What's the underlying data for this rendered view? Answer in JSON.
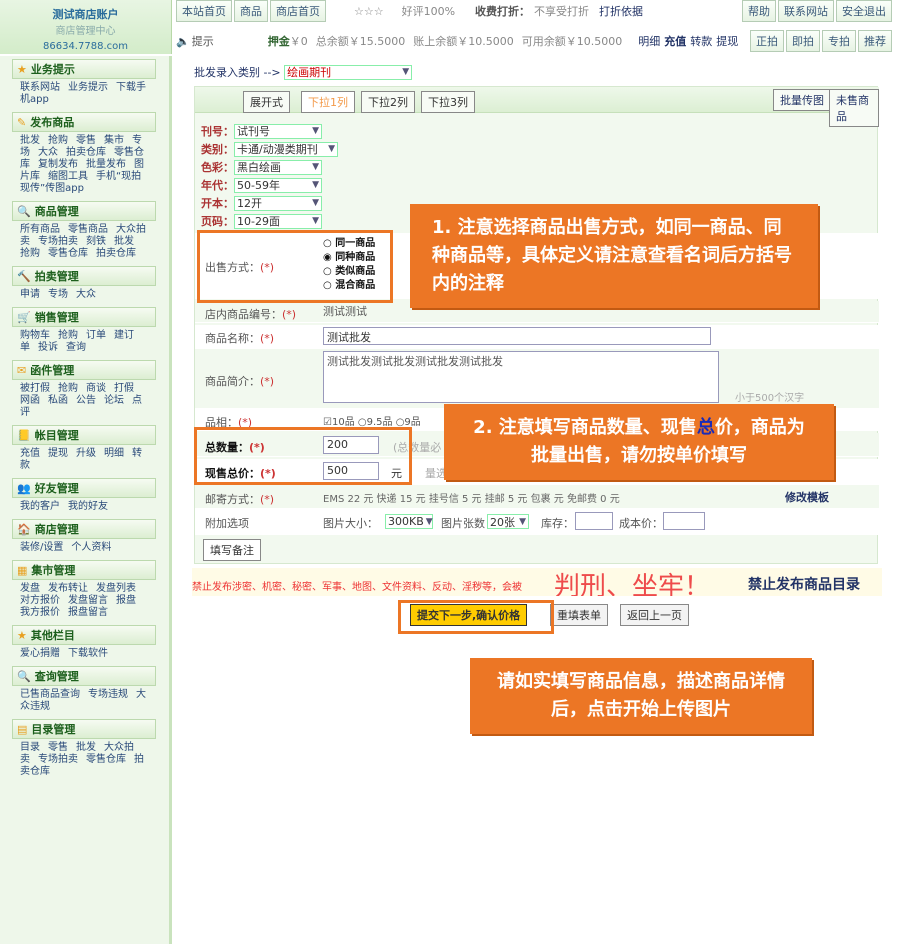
{
  "header": {
    "logo_title": "测试商店账户",
    "logo_sub": "商店管理中心",
    "logo_url": "86634.7788.com",
    "row1": [
      "本站首页",
      "商品",
      "商店首页"
    ],
    "stars": "☆☆☆",
    "rating": "好评100%",
    "fee_label": "收费打折：",
    "fee_value": "不享受打折",
    "fee_link": "打折依据",
    "row1_right": [
      "帮助",
      "联系网站",
      "安全退出"
    ],
    "tip": "提示",
    "deposit_label": "押金",
    "deposit_value": "￥0",
    "balance": "总余额￥15.5000",
    "account": "账上余额￥10.5000",
    "available": "可用余额￥10.5000",
    "links": [
      "明细",
      "充值",
      "转款",
      "提现"
    ],
    "row2_right": [
      "正拍",
      "即拍",
      "专拍",
      "推荐"
    ]
  },
  "sidebar": [
    {
      "title": "业务提示",
      "items": [
        "联系网站",
        "业务提示",
        "下载手机app"
      ]
    },
    {
      "title": "发布商品",
      "items": [
        "批发",
        "抢购",
        "零售",
        "集市",
        "专场",
        "大众",
        "拍卖仓库",
        "零售仓库",
        "复制发布",
        "批量发布",
        "图片库",
        "缩图工具",
        "手机“现拍现传”传图app"
      ]
    },
    {
      "title": "商品管理",
      "items": [
        "所有商品",
        "零售商品",
        "大众拍卖",
        "专场拍卖",
        "刻铁",
        "批发",
        "抢购",
        "零售仓库",
        "拍卖仓库"
      ]
    },
    {
      "title": "拍卖管理",
      "items": [
        "申请",
        "专场",
        "大众"
      ]
    },
    {
      "title": "销售管理",
      "items": [
        "购物车",
        "抢购",
        "订单",
        "建订单",
        "投诉",
        "查询"
      ]
    },
    {
      "title": "函件管理",
      "items": [
        "被打假",
        "抢购",
        "商谈",
        "打假",
        "网函",
        "私函",
        "公告",
        "论坛",
        "点评"
      ]
    },
    {
      "title": "帐目管理",
      "items": [
        "充值",
        "提现",
        "升级",
        "明细",
        "转款"
      ]
    },
    {
      "title": "好友管理",
      "items": [
        "我的客户",
        "我的好友"
      ]
    },
    {
      "title": "商店管理",
      "items": [
        "装修/设置",
        "个人资料"
      ]
    },
    {
      "title": "集市管理",
      "items": [
        "发盘",
        "发布转让",
        "发盘列表",
        "对方报价",
        "发盘留言",
        "报盘",
        "我方报价",
        "报盘留言"
      ]
    },
    {
      "title": "其他栏目",
      "items": [
        "爱心捐赠",
        "下载软件"
      ]
    },
    {
      "title": "查询管理",
      "items": [
        "已售商品查询",
        "专场违规",
        "大众违规"
      ]
    },
    {
      "title": "目录管理",
      "items": [
        "目录",
        "零售",
        "批发",
        "大众拍卖",
        "专场拍卖",
        "零售仓库",
        "拍卖仓库"
      ]
    }
  ],
  "form": {
    "category_label": "批发录入类别 -->",
    "category_value": "绘画期刊",
    "tabs": [
      "展开式",
      "下拉1列",
      "下拉2列",
      "下拉3列"
    ],
    "right_btns": [
      "批量传图",
      "未售商品"
    ],
    "fields": [
      {
        "label": "刊号：",
        "value": "试刊号"
      },
      {
        "label": "类别：",
        "value": "卡通/动漫类期刊"
      },
      {
        "label": "色彩：",
        "value": "黑白绘画"
      },
      {
        "label": "年代：",
        "value": "50-59年"
      },
      {
        "label": "开本：",
        "value": "12开"
      },
      {
        "label": "页码：",
        "value": "10-29面"
      }
    ],
    "sale_label": "出售方式：",
    "sale_options": [
      "同一商品",
      "同种商品",
      "类似商品",
      "混合商品"
    ],
    "shop_code_label": "店内商品编号：",
    "shop_code": "测试测试",
    "name_label": "商品名称：",
    "name_value": "测试批发",
    "desc_label": "商品简介：",
    "desc_value": "测试批发测试批发测试批发测试批发",
    "desc_hint": "小于500个汉字",
    "grade_label": "品相：",
    "grade_opts": [
      "10品",
      "9.5品",
      "9品"
    ],
    "qty_label": "总数量：",
    "qty_value": "200",
    "qty_hint": "(总数量必",
    "price_label": "现售总价：",
    "price_value": "500",
    "price_unit": "元",
    "price_hint": "量选",
    "mail_label": "邮寄方式：",
    "mail_text": "EMS 22 元 快递 15 元 挂号信 5 元 挂邮 5 元 包裹 元 免邮费 0 元",
    "mail_link": "修改模板",
    "extra_label": "附加选项",
    "pic_size_label": "图片大小：",
    "pic_size": "300KB",
    "pic_count_label": "图片张数",
    "pic_count": "20张",
    "stock_label": "库存：",
    "cost_label": "成本价：",
    "note_btn": "填写备注"
  },
  "warning": {
    "small": "禁止发布涉密、机密、秘密、军事、地图、文件资料、反动、淫秽等，会被",
    "big": "判刑、坐牢！",
    "link": "禁止发布商品目录"
  },
  "actions": {
    "submit": "提交下一步,确认价格",
    "reset": "重填表单",
    "back": "返回上一页"
  },
  "callouts": {
    "c1": "1. 注意选择商品出售方式，如同一商品、同种商品等，具体定义请注意查看名词后方括号内的注释",
    "c2": "2. 注意填写商品数量、现售总价，商品为批量出售，请勿按单价填写",
    "c2_highlight": "总",
    "c3": "请如实填写商品信息，描述商品详情后，点击开始上传图片"
  }
}
